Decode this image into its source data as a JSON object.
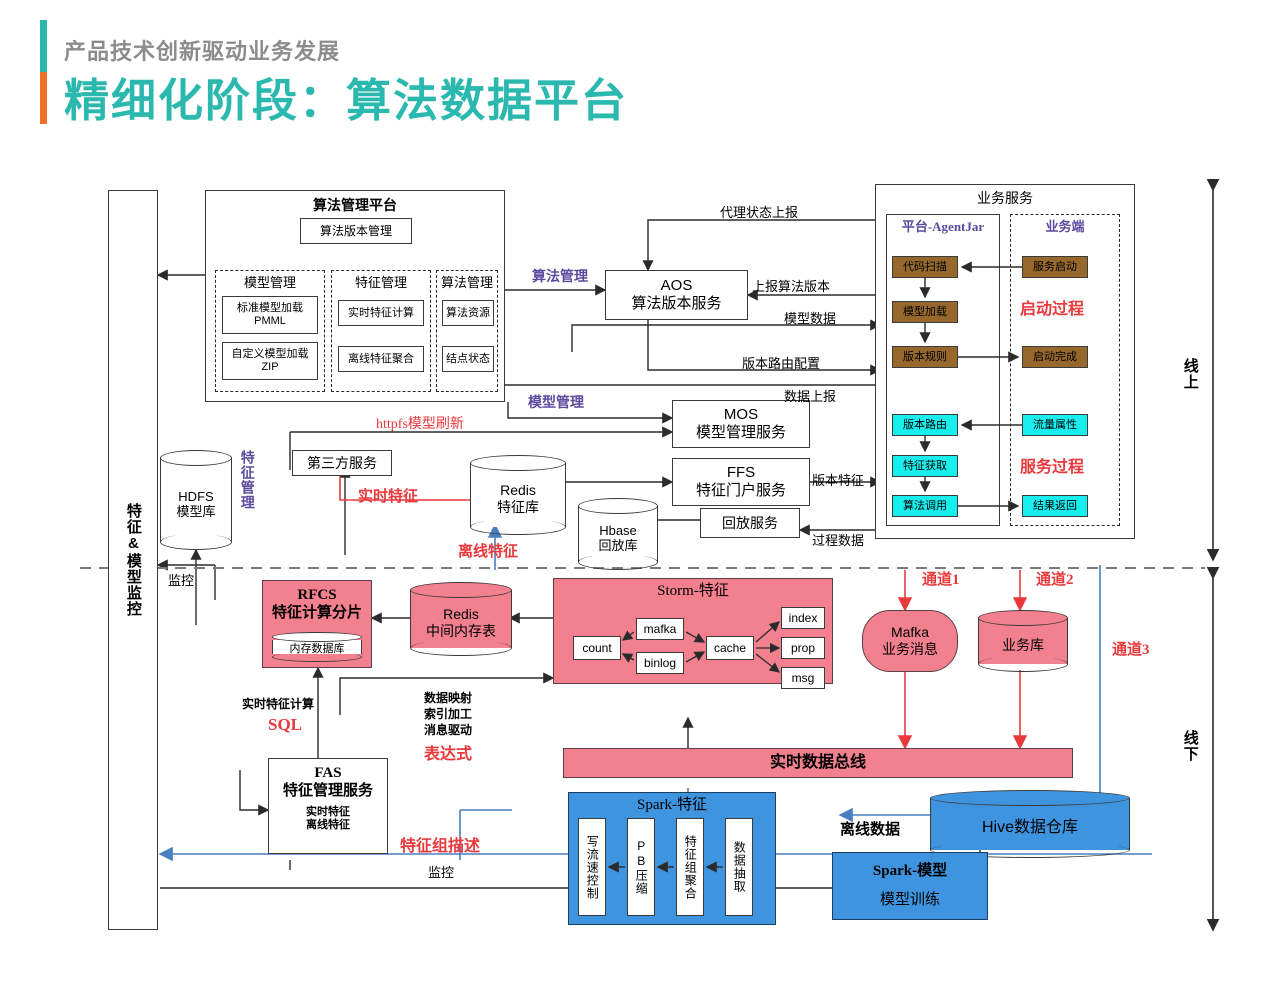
{
  "header": {
    "kicker": "产品技术创新驱动业务发展",
    "title": "精细化阶段：算法数据平台",
    "accent_teal": "#2BB8AE",
    "accent_orange": "#F0702A"
  },
  "monitor_column": {
    "label": "特征&模型监控"
  },
  "platform": {
    "title": "算法管理平台",
    "version_mgmt": "算法版本管理",
    "groups": [
      {
        "title": "模型管理",
        "items": [
          "标准模型加载\nPMML",
          "自定义模型加载\nZIP"
        ]
      },
      {
        "title": "特征管理",
        "items": [
          "实时特征计算",
          "离线特征聚合"
        ]
      },
      {
        "title": "算法管理",
        "items": [
          "算法资源",
          "结点状态"
        ]
      }
    ]
  },
  "services": {
    "aos": "AOS\n算法版本服务",
    "mos": "MOS\n模型管理服务",
    "ffs": "FFS\n特征门户服务",
    "replay": "回放服务",
    "third_party": "第三方服务"
  },
  "stores": {
    "hdfs": "HDFS\n模型库",
    "redis_feature": "Redis\n特征库",
    "hbase": "Hbase\n回放库",
    "redis_mid": "Redis\n中间内存表",
    "mafka": "Mafka\n业务消息",
    "biz_db": "业务库",
    "hive": "Hive数据仓库"
  },
  "business": {
    "title": "业务服务",
    "agent_jar": "平台-AgentJar",
    "biz_side": "业务端",
    "startup_phase": "启动过程",
    "service_phase": "服务过程",
    "agent_startup": [
      "代码扫描",
      "模型加载",
      "版本规则"
    ],
    "agent_service": [
      "版本路由",
      "特征获取",
      "算法调用"
    ],
    "biz_startup": [
      "服务启动",
      "启动完成"
    ],
    "biz_service": [
      "流量属性",
      "结果返回"
    ]
  },
  "edge_labels": {
    "algo_mgmt": "算法管理",
    "model_mgmt": "模型管理",
    "feature_mgmt": "特征管理",
    "agent_status": "代理状态上报",
    "report_version": "上报算法版本",
    "model_data": "模型数据",
    "version_route_cfg": "版本路由配置",
    "data_report": "数据上报",
    "httpfs_refresh": "httpfs模型刷新",
    "realtime_feature": "实时特征",
    "offline_feature": "离线特征",
    "version_feature": "版本特征",
    "process_data": "过程数据",
    "monitor_top": "监控",
    "monitor_bottom": "监控",
    "realtime_sql": "实时特征计算",
    "sql": "SQL",
    "mapping_lines": "数据映射\n索引加工\n消息驱动",
    "expression": "表达式",
    "feature_group_desc": "特征组描述",
    "offline_data": "离线数据",
    "channel1": "通道1",
    "channel2": "通道2",
    "channel3": "通道3",
    "online": "线上",
    "offline": "线下"
  },
  "compute": {
    "rfcs": "RFCS\n特征计算分片",
    "rfcs_sub": "内存数据库",
    "fas": "FAS\n特征管理服务",
    "fas_sub": "实时特征\n离线特征",
    "storm_title": "Storm-特征",
    "storm_nodes": [
      "count",
      "mafka",
      "binlog",
      "cache",
      "index",
      "prop",
      "msg"
    ],
    "databus": "实时数据总线",
    "spark_feature_title": "Spark-特征",
    "spark_feature_steps": [
      "写流速控制",
      "PB压缩",
      "特征组聚合",
      "数据抽取"
    ],
    "spark_model": "Spark-模型",
    "spark_model_sub": "模型训练"
  }
}
